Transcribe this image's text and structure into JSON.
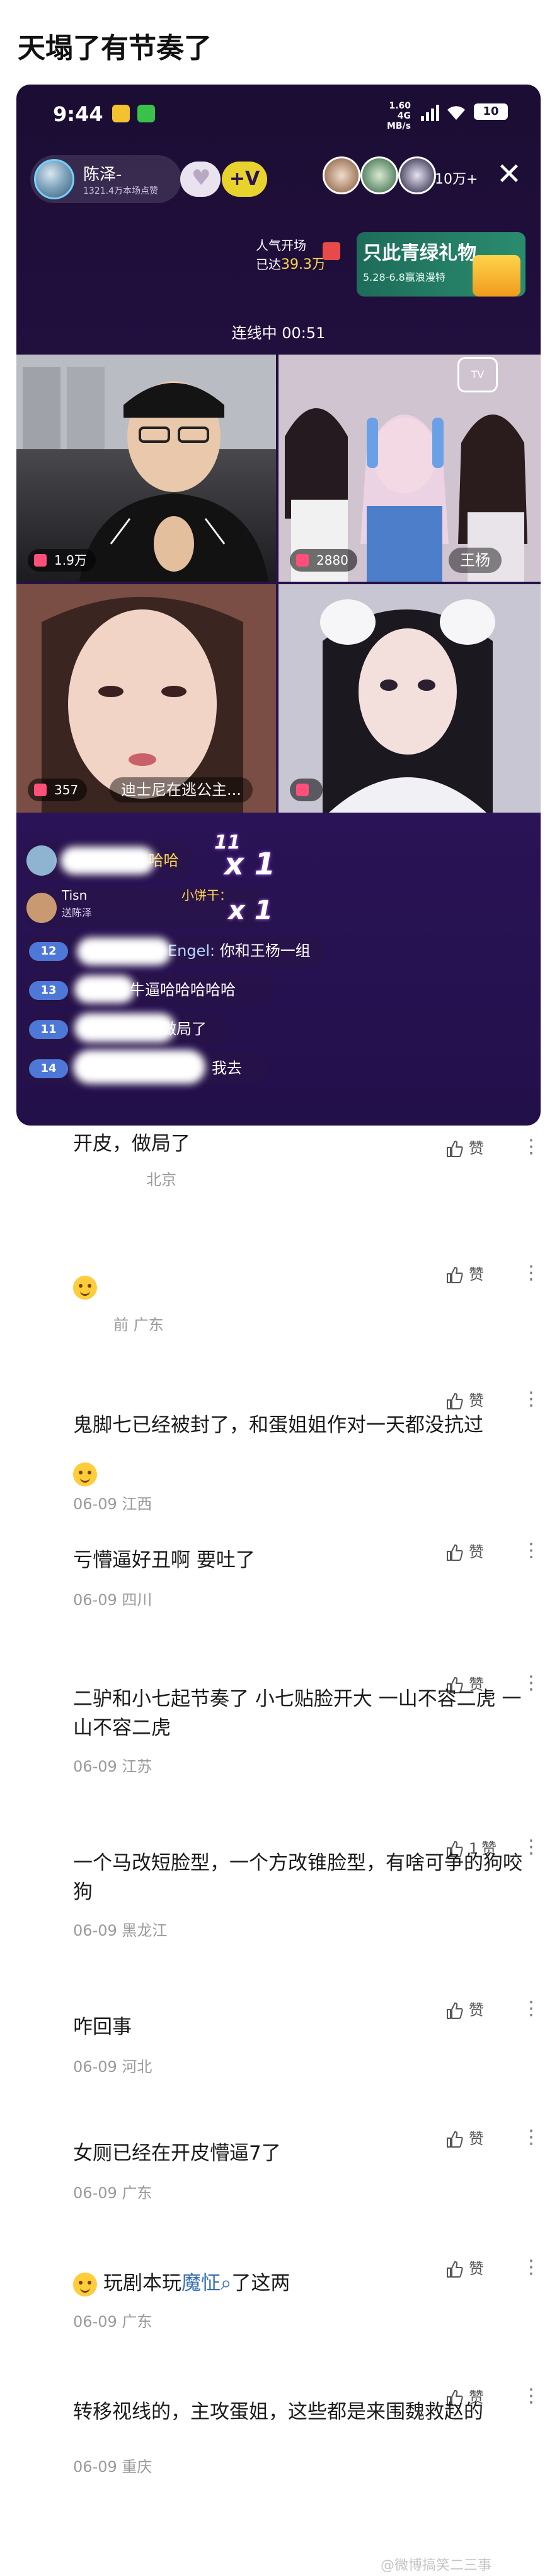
{
  "post": {
    "title": "天塌了有节奏了"
  },
  "live": {
    "status_bar": {
      "time": "9:44",
      "network_speed": "1.60",
      "network_unit": "MB/s",
      "network_type": "4G",
      "battery": "10"
    },
    "host": {
      "name": "陈泽-",
      "likes": "1321.4万本场点赞"
    },
    "follow_label": "+V",
    "viewer_count": "10万+",
    "popularity": {
      "line1": "人气开场",
      "line2_prefix": "已达",
      "line2_value": "39.3万"
    },
    "banner": {
      "title": "只此青绿礼物",
      "subtitle": "5.28-6.8赢浪漫特"
    },
    "mic_status": "连线中 00:51",
    "tiles": [
      {
        "badge": "1.9万"
      },
      {
        "badge": "2880",
        "name": "王杨"
      },
      {
        "badge": "357",
        "name": "迪士尼在逃公主..."
      },
      {
        "badge": ""
      }
    ],
    "tv_label": "TV",
    "chat": {
      "gift_user": "哈哈",
      "combo1": "11",
      "combo1_x": "x 1",
      "gift2_user": "Tisn",
      "gift2_label": "送陈泽",
      "gift2_item": "小饼干：",
      "combo2_x": "x 1",
      "messages": [
        {
          "level": "12",
          "user": "Engel:",
          "text": "你和王杨一组"
        },
        {
          "level": "13",
          "user": "",
          "text": "牛逼哈哈哈哈哈"
        },
        {
          "level": "11",
          "user": "",
          "text": "做局了"
        },
        {
          "level": "14",
          "user": "",
          "text": "我去"
        }
      ]
    }
  },
  "like_label": "赞",
  "comments": [
    {
      "text": "开皮，做局了",
      "meta": "北京",
      "likes": ""
    },
    {
      "text": "",
      "meta": "前 广东",
      "likes": ""
    },
    {
      "text": "鬼脚七已经被封了，和蛋姐姐作对一天都没抗过",
      "meta": "06-09 江西",
      "likes": ""
    },
    {
      "text": "亏懵逼好丑啊 要吐了",
      "meta": "06-09 四川",
      "likes": ""
    },
    {
      "text": "二驴和小七起节奏了 小七贴脸开大 一山不容二虎 一山不容二虎",
      "meta": "06-09 江苏",
      "likes": ""
    },
    {
      "text": "一个马改短脸型，一个方改锥脸型，有啥可争的狗咬狗",
      "meta": "06-09 黑龙江",
      "likes": "1"
    },
    {
      "text": "咋回事",
      "meta": "06-09 河北",
      "likes": ""
    },
    {
      "text": "女厕已经在开皮懵逼7了",
      "meta": "06-09 广东",
      "likes": ""
    },
    {
      "text_prefix": "玩剧本玩",
      "link": "魔怔",
      "text_suffix": "了这两",
      "meta": "06-09 广东",
      "likes": ""
    },
    {
      "text": "转移视线的，主攻蛋姐，这些都是来围魏救赵的",
      "meta": "06-09 重庆",
      "likes": ""
    }
  ],
  "watermark": "@微博搞笑二三事"
}
